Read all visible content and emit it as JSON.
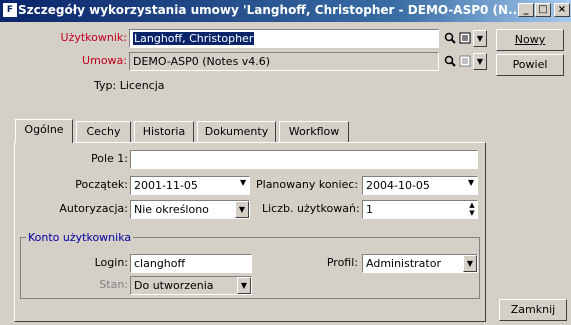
{
  "window": {
    "title": "Szczegóły wykorzystania umowy 'Langhoff, Christopher - DEMO-ASP0 (N...",
    "minimize": "_",
    "maximize": "□",
    "close": "×"
  },
  "form": {
    "user_label": "Użytkownik:",
    "user_value": "Langhoff, Christopher",
    "contract_label": "Umowa:",
    "contract_value": "DEMO-ASP0 (Notes v4.6)",
    "type_text": "Typ: Licencja"
  },
  "buttons": {
    "new": "Nowy",
    "repeat": "Powiel",
    "close": "Zamknij"
  },
  "tabs": [
    {
      "label": "Ogólne",
      "active": true
    },
    {
      "label": "Cechy"
    },
    {
      "label": "Historia"
    },
    {
      "label": "Dokumenty"
    },
    {
      "label": "Workflow"
    }
  ],
  "general": {
    "field1_label": "Pole 1:",
    "field1_value": "",
    "start_label": "Początek:",
    "start_value": "2001-11-05",
    "planned_end_label": "Planowany koniec:",
    "planned_end_value": "2004-10-05",
    "authorization_label": "Autoryzacja:",
    "authorization_value": "Nie określono",
    "user_count_label": "Liczb. użytkowań:",
    "user_count_value": "1"
  },
  "account": {
    "group_title": "Konto użytkownika",
    "login_label": "Login:",
    "login_value": "clanghoff",
    "profile_label": "Profil:",
    "profile_value": "Administrator",
    "status_label": "Stan:",
    "status_value": "Do utworzenia"
  },
  "icons": {
    "window": "window-app-icon",
    "search": "search-icon",
    "details": "details-icon",
    "dropdown": "chevron-down-icon",
    "spinner": "spinner-icon"
  }
}
